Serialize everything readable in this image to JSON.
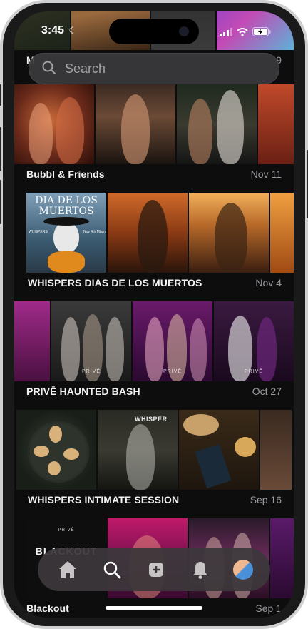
{
  "status": {
    "time": "3:45"
  },
  "search": {
    "placeholder": "Search"
  },
  "top_partial": {
    "name_fragment": "M",
    "date_fragment": "9"
  },
  "events": [
    {
      "name": "Bubbl & Friends",
      "date": "Nov 11"
    },
    {
      "name": "WHISPERS DIAS DE LOS MUERTOS",
      "date": "Nov 4",
      "poster_title": "DIA DE LOS\nMUERTOS",
      "poster_small": "WHISPERS",
      "poster_right": "Nov 4th Miami"
    },
    {
      "name": "PRIVĒ HAUNTED BASH",
      "date": "Oct 27",
      "watermark": "PRIVĒ"
    },
    {
      "name": "WHISPERS INTIMATE SESSION",
      "date": "Sep 16",
      "sign": "WHISPER"
    },
    {
      "name": "Blackout",
      "date": "Sep 1",
      "poster_title": "BLACKOUT",
      "poster_small": "PRIVĒ"
    }
  ],
  "tabs": [
    "home-icon",
    "search-icon",
    "create-icon",
    "bell-icon",
    "avatar"
  ],
  "colors": {
    "background": "#0d0d0e",
    "tabbar": "#3c373a",
    "text": "#f2f2f2",
    "muted": "#9a9a9f"
  }
}
